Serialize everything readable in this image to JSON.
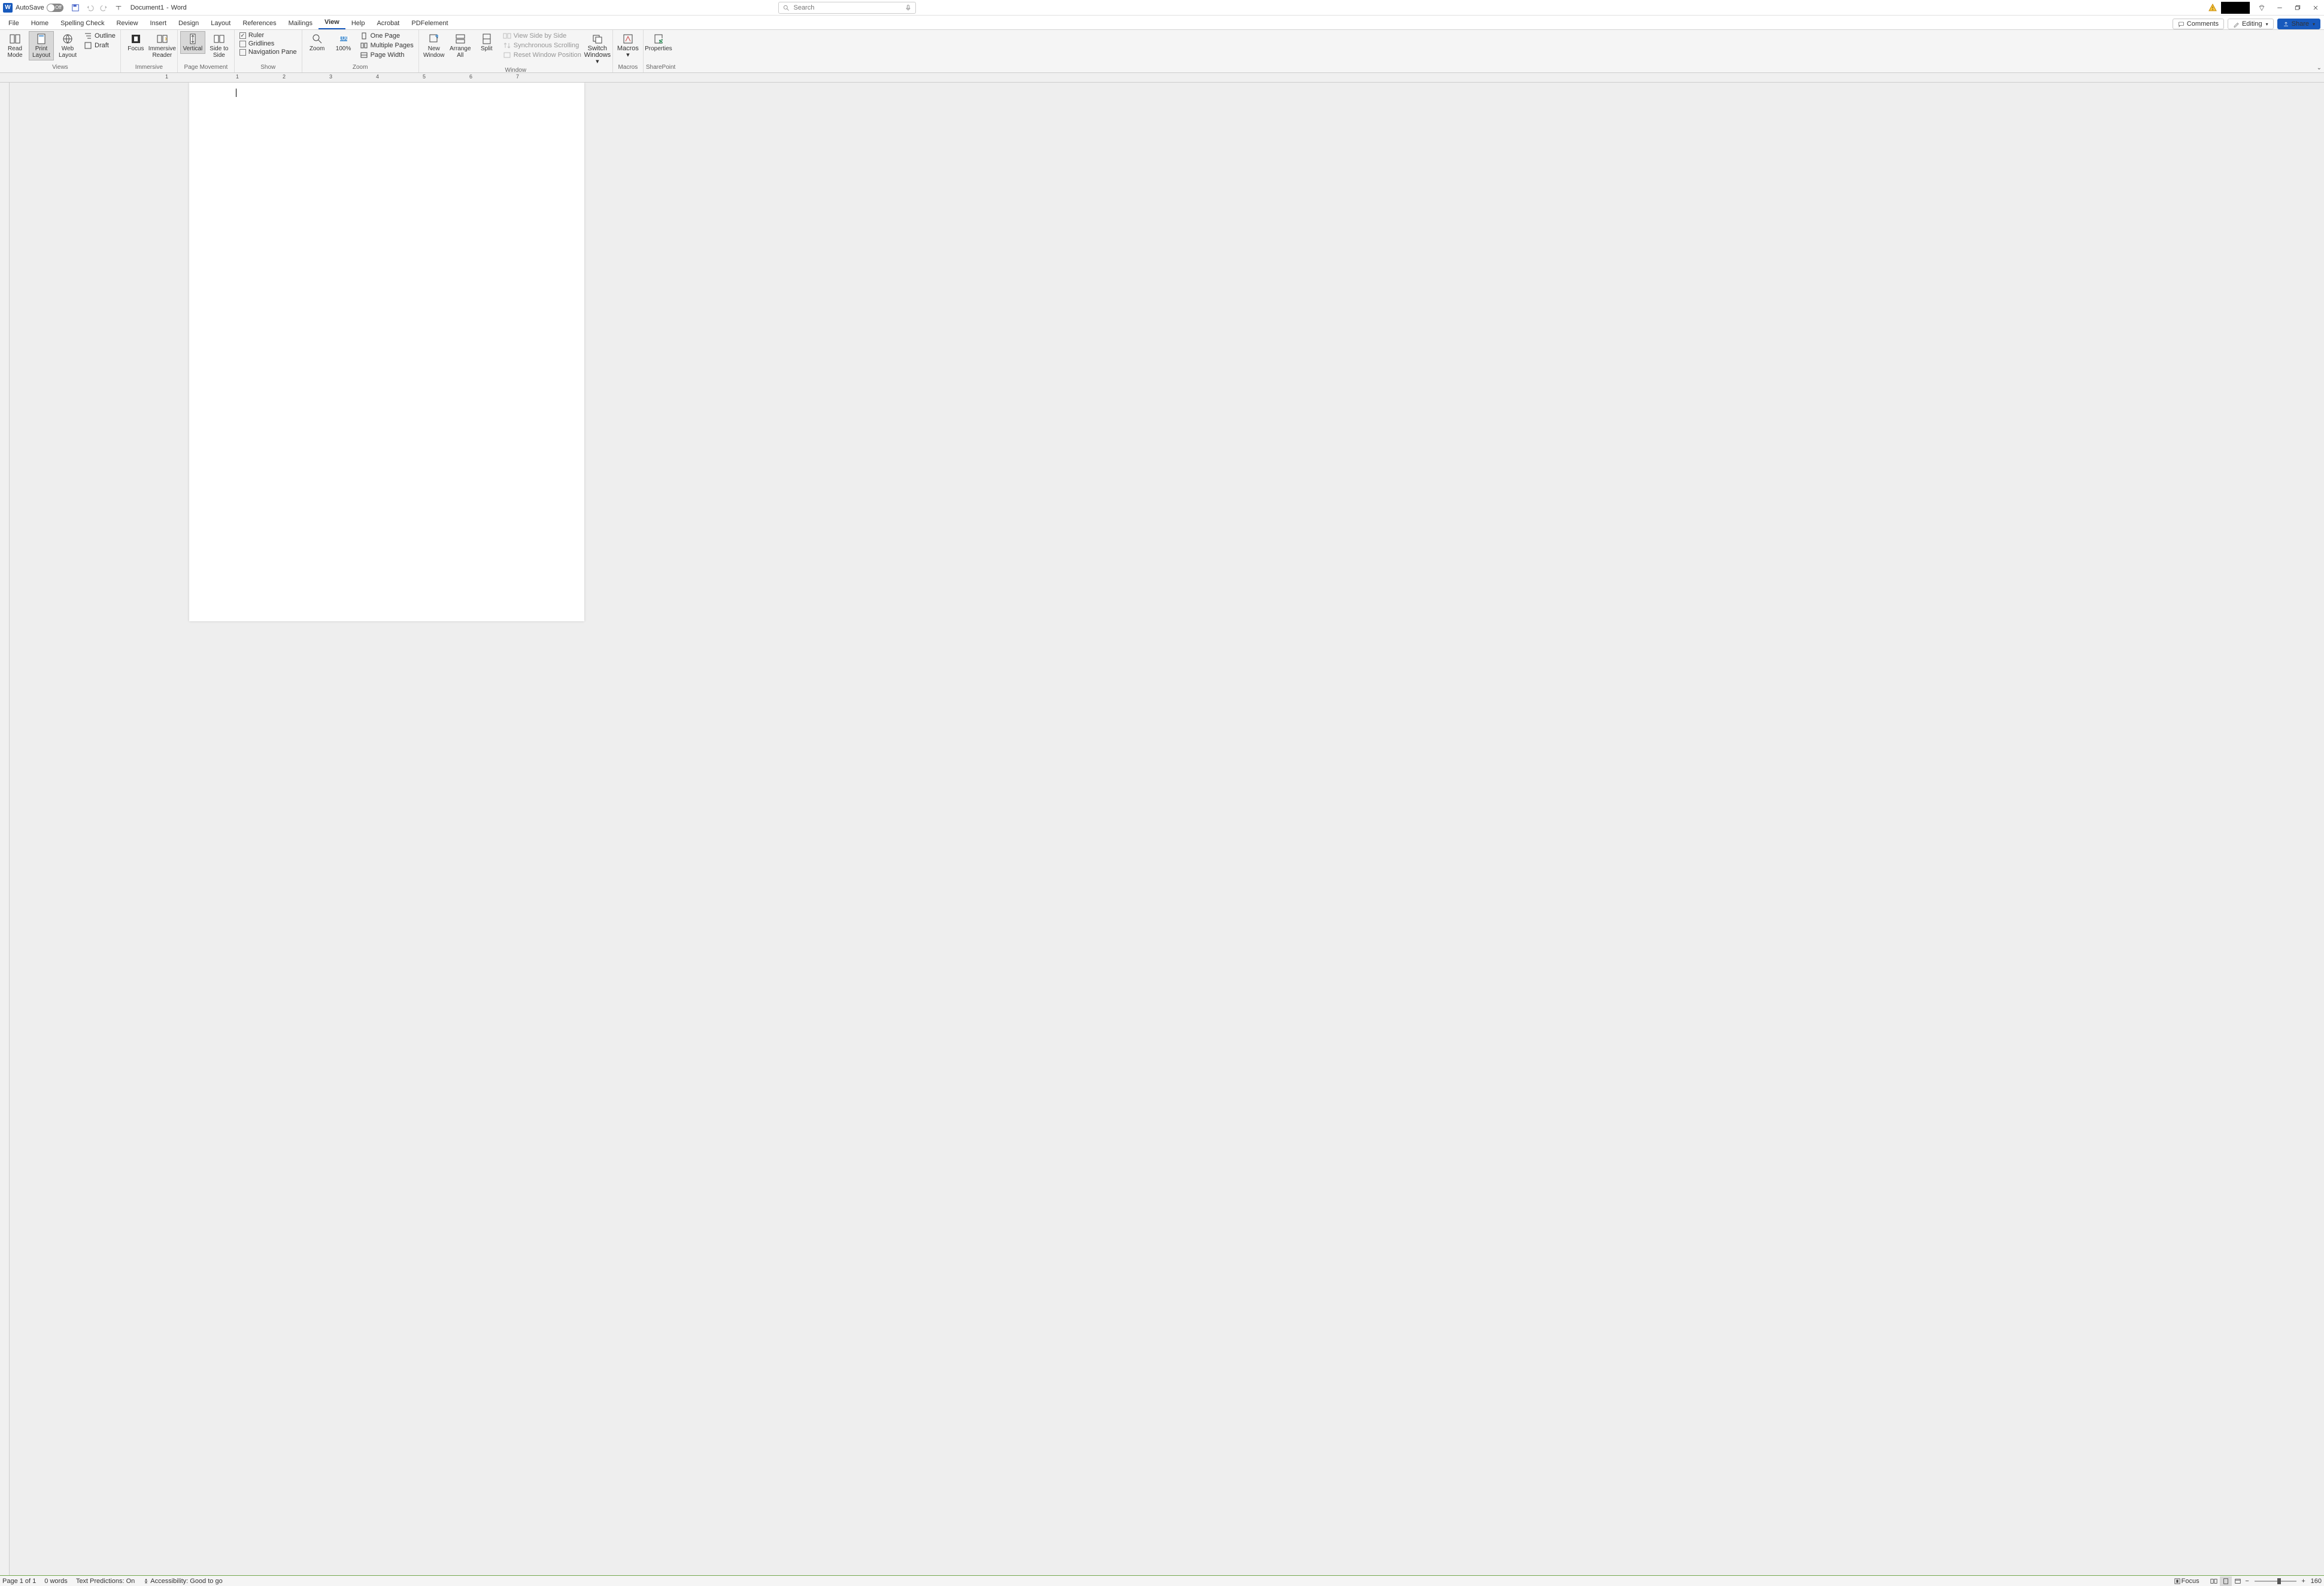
{
  "titlebar": {
    "autosave_label": "AutoSave",
    "autosave_state": "Off",
    "doc_name": "Document1",
    "app_name": "Word",
    "search_placeholder": "Search"
  },
  "tabs": {
    "items": [
      "File",
      "Home",
      "Spelling Check",
      "Review",
      "Insert",
      "Design",
      "Layout",
      "References",
      "Mailings",
      "View",
      "Help",
      "Acrobat",
      "PDFelement"
    ],
    "active": "View",
    "comments": "Comments",
    "editing": "Editing",
    "share": "Share"
  },
  "ribbon": {
    "views": {
      "read": "Read Mode",
      "print": "Print Layout",
      "web": "Web Layout",
      "outline": "Outline",
      "draft": "Draft",
      "label": "Views"
    },
    "immersive": {
      "focus": "Focus",
      "reader": "Immersive Reader",
      "label": "Immersive"
    },
    "pagemove": {
      "vertical": "Vertical",
      "side": "Side to Side",
      "label": "Page Movement"
    },
    "show": {
      "ruler": "Ruler",
      "gridlines": "Gridlines",
      "navpane": "Navigation Pane",
      "label": "Show"
    },
    "zoom": {
      "zoom": "Zoom",
      "hundred": "100%",
      "onepage": "One Page",
      "multipage": "Multiple Pages",
      "pagewidth": "Page Width",
      "label": "Zoom"
    },
    "window": {
      "newwin": "New Window",
      "arrange": "Arrange All",
      "split": "Split",
      "sidebyside": "View Side by Side",
      "sync": "Synchronous Scrolling",
      "reset": "Reset Window Position",
      "switch": "Switch Windows",
      "label": "Window"
    },
    "macros": {
      "macros": "Macros",
      "label": "Macros"
    },
    "sharepoint": {
      "props": "Properties",
      "label": "SharePoint"
    }
  },
  "ruler_numbers_left": [
    "1"
  ],
  "ruler_numbers_right": [
    "1",
    "2",
    "3",
    "4",
    "5",
    "6",
    "7"
  ],
  "statusbar": {
    "page": "Page 1 of 1",
    "words": "0 words",
    "predictions": "Text Predictions: On",
    "accessibility": "Accessibility: Good to go",
    "focus": "Focus",
    "zoom_value": "160"
  }
}
